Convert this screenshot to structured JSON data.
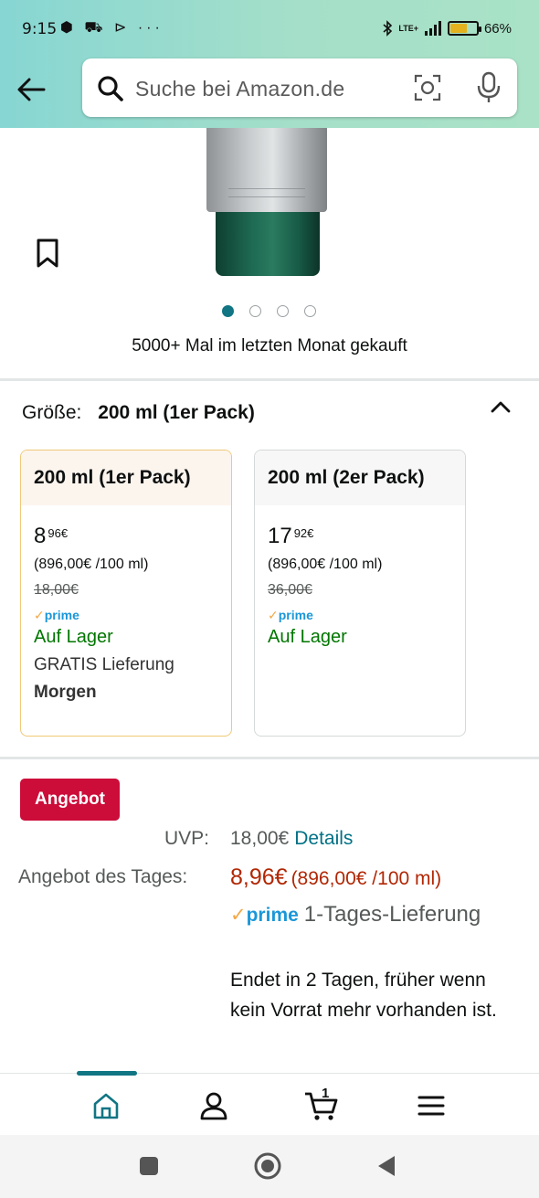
{
  "status_bar": {
    "time": "9:15",
    "notification_icons": "⬢ ⛟ ⊳ ···",
    "network": "LTE+",
    "battery_percent": "66%",
    "battery_level": 0.66
  },
  "search": {
    "placeholder": "Suche bei Amazon.de"
  },
  "gallery": {
    "image_count": 4,
    "active_index": 0,
    "purchase_note": "5000+ Mal im letzten Monat gekauft"
  },
  "size_selector": {
    "label": "Größe:",
    "selected": "200 ml (1er Pack)",
    "options": [
      {
        "name": "200 ml (1er Pack)",
        "price_whole": "8",
        "price_fraction": "96",
        "currency": "€",
        "unit_price": "(896,00€ /100 ml)",
        "list_price": "18,00€",
        "prime": "prime",
        "stock": "Auf Lager",
        "delivery": "GRATIS Lieferung",
        "delivery_day": "Morgen"
      },
      {
        "name": "200 ml (2er Pack)",
        "price_whole": "17",
        "price_fraction": "92",
        "currency": "€",
        "unit_price": "(896,00€ /100 ml)",
        "list_price": "36,00€",
        "prime": "prime",
        "stock": "Auf Lager"
      }
    ]
  },
  "deal": {
    "badge": "Angebot",
    "uvp_label": "UVP:",
    "uvp_value": "18,00€",
    "details_link": "Details",
    "deal_label": "Angebot des Tages:",
    "deal_price": "8,96€",
    "deal_unit_price": "(896,00€ /100 ml)",
    "prime": "prime",
    "prime_delivery": "1-Tages-Lieferung",
    "ends_text": "Endet in 2 Tagen, früher wenn kein Vorrat mehr vorhanden ist."
  },
  "bottom_nav": {
    "items": [
      "home-icon",
      "account-icon",
      "cart-icon",
      "menu-icon"
    ],
    "active": "home-icon",
    "cart_count": "1"
  },
  "colors": {
    "accent": "#117583",
    "deal_red": "#cc0c39",
    "price_red": "#b12704",
    "stock_green": "#007600",
    "prime_blue": "#1b97d8"
  }
}
